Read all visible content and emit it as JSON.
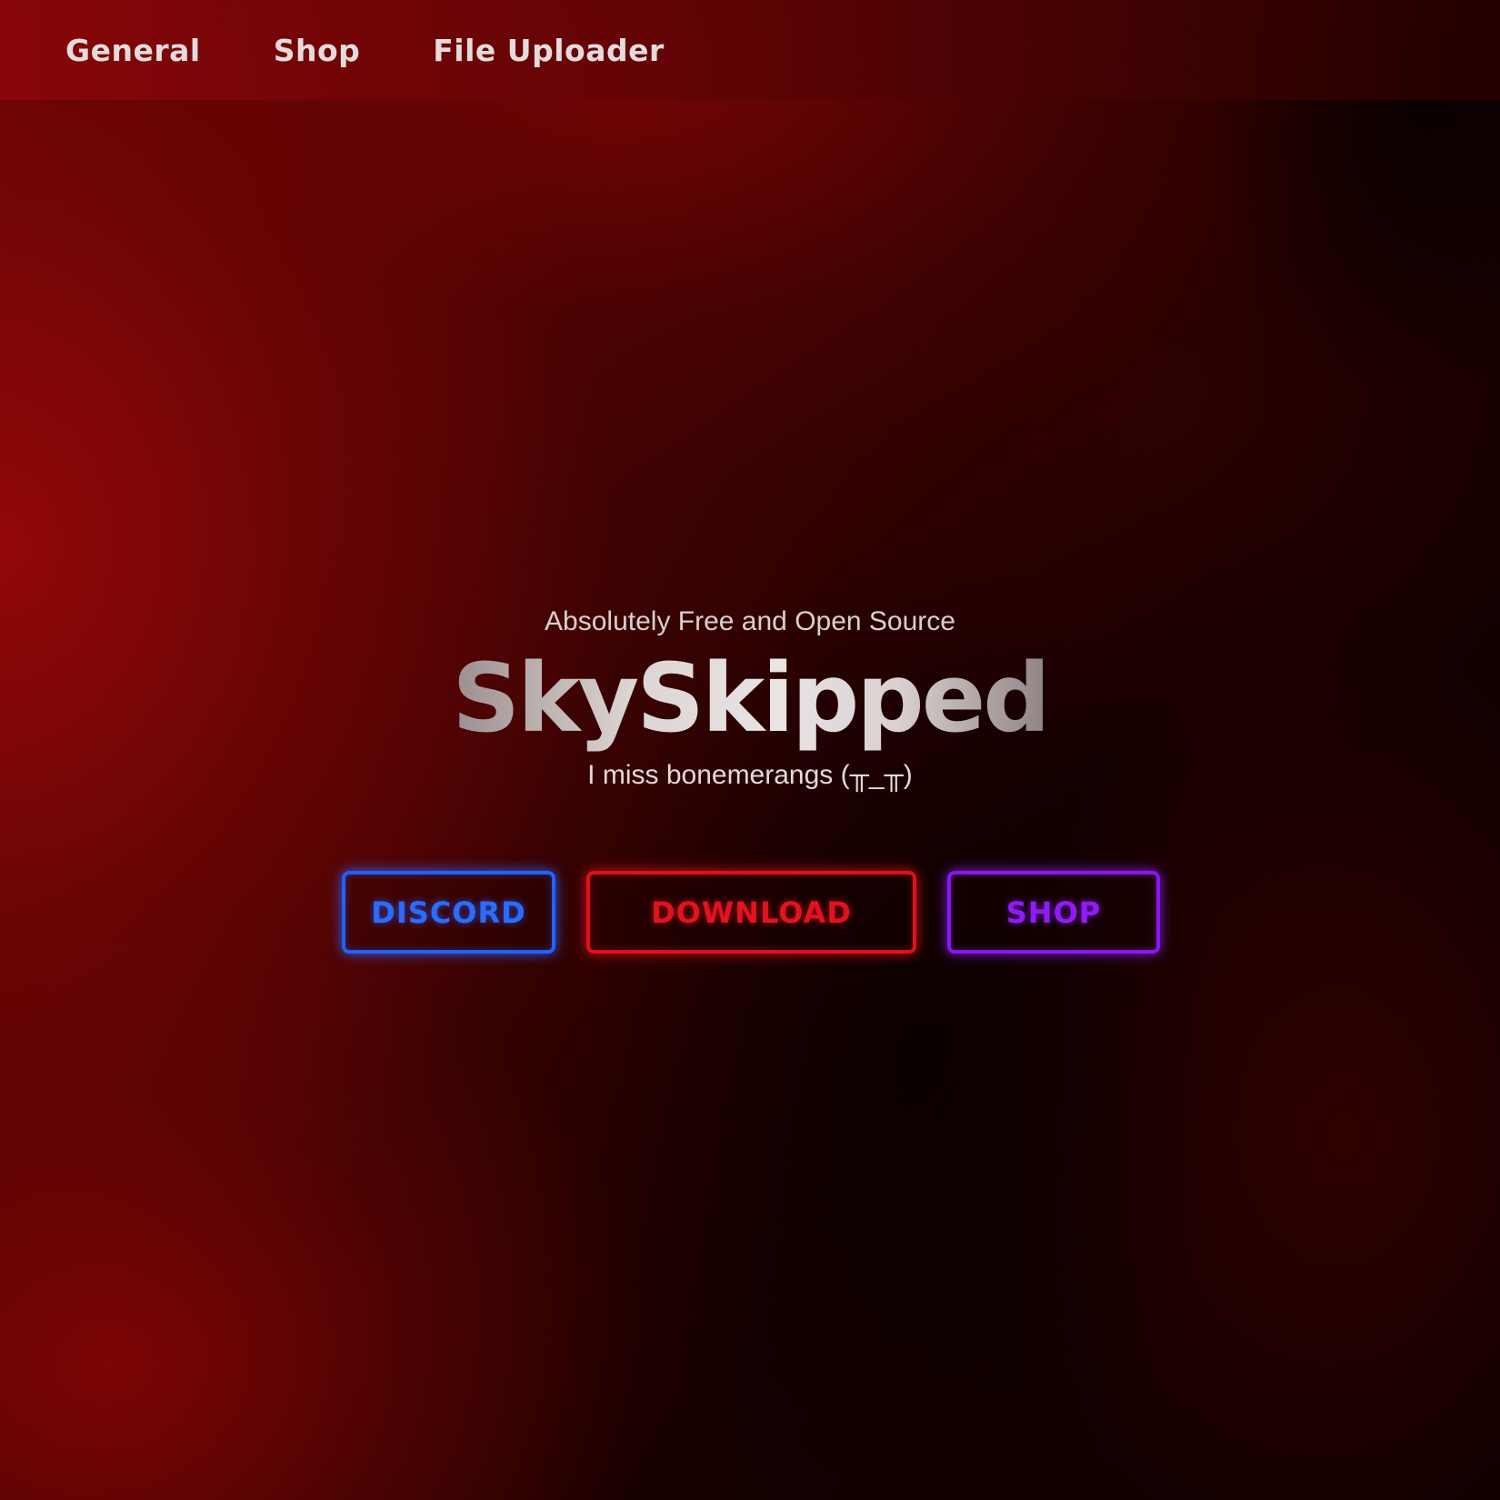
{
  "nav": {
    "items": [
      {
        "label": "General"
      },
      {
        "label": "Shop"
      },
      {
        "label": "File Uploader"
      }
    ]
  },
  "hero": {
    "tagline": "Absolutely Free and Open Source",
    "title": "SkySkipped",
    "subtitle": "I miss bonemerangs (╥_╥)"
  },
  "buttons": {
    "discord": {
      "label": "DISCORD",
      "color": "#2a6cff"
    },
    "download": {
      "label": "DOWNLOAD",
      "color": "#e21220"
    },
    "shop": {
      "label": "SHOP",
      "color": "#8f1cf5"
    }
  },
  "colors": {
    "background_primary": "#6a0404",
    "background_dark": "#0a0000",
    "text": "#e6dede"
  }
}
